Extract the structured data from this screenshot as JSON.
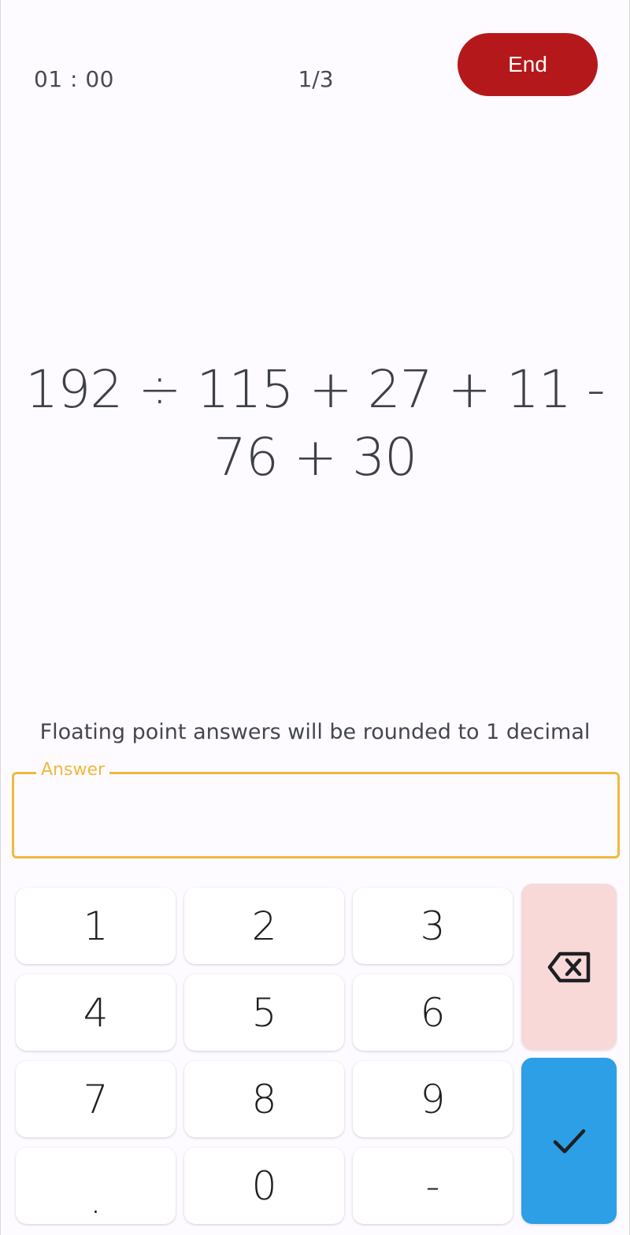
{
  "header": {
    "timer": "01 : 00",
    "progress": "1/3",
    "end_label": "End"
  },
  "question": {
    "expression": "192 ÷ 115 + 27 + 11 - 76 + 30"
  },
  "hint": "Floating point answers will be rounded to 1 decimal",
  "answer": {
    "label": "Answer",
    "value": ""
  },
  "keypad": {
    "keys": [
      "1",
      "2",
      "3",
      "4",
      "5",
      "6",
      "7",
      "8",
      "9",
      ".",
      "0",
      "-"
    ],
    "backspace_icon": "backspace-icon",
    "submit_icon": "check-icon"
  },
  "colors": {
    "end_button": "#b5181a",
    "answer_accent": "#f0b93e",
    "backspace_bg": "#f8d9d8",
    "submit_bg": "#2d9fe6"
  }
}
